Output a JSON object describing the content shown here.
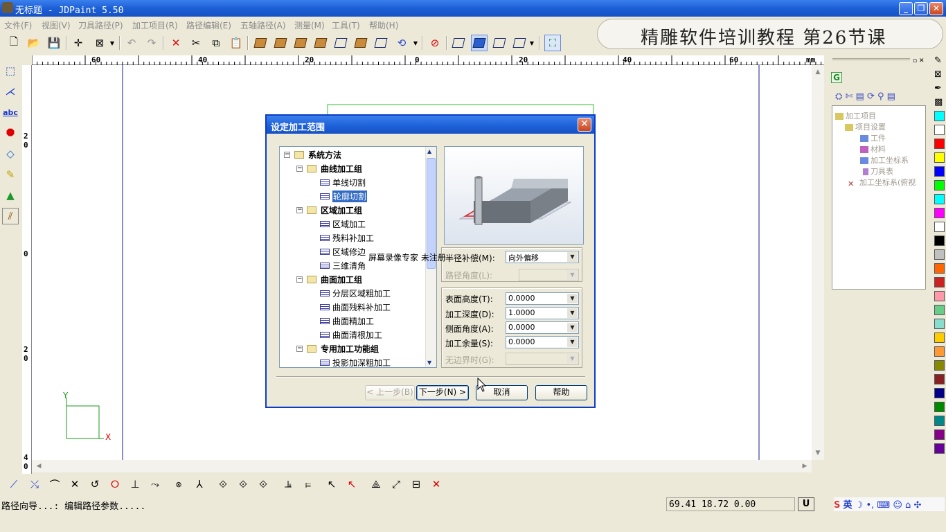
{
  "window": {
    "title": "无标题 - JDPaint 5.50"
  },
  "menu": [
    "文件(F)",
    "视图(V)",
    "刀具路径(P)",
    "加工项目(R)",
    "路径编辑(E)",
    "五轴路径(A)",
    "测量(M)",
    "工具(T)",
    "帮助(H)"
  ],
  "banner": "精雕软件培训教程 第26节课",
  "ruler": {
    "unit": "mm",
    "h_labels": [
      "60",
      "40",
      "20",
      "0",
      "20",
      "40",
      "60"
    ],
    "v_labels": [
      "2\n0",
      "0",
      "2\n0",
      "4\n0"
    ]
  },
  "axes": {
    "x": "X",
    "y": "Y"
  },
  "dialog": {
    "title": "设定加工范围",
    "close": "✕",
    "tree": [
      {
        "label": "系统方法",
        "level": 0,
        "type": "folder"
      },
      {
        "label": "曲线加工组",
        "level": 1,
        "type": "folder"
      },
      {
        "label": "单线切割",
        "level": 2,
        "type": "leaf"
      },
      {
        "label": "轮廓切割",
        "level": 2,
        "type": "leaf",
        "selected": true
      },
      {
        "label": "区域加工组",
        "level": 1,
        "type": "folder"
      },
      {
        "label": "区域加工",
        "level": 2,
        "type": "leaf"
      },
      {
        "label": "残料补加工",
        "level": 2,
        "type": "leaf"
      },
      {
        "label": "区域修边",
        "level": 2,
        "type": "leaf"
      },
      {
        "label": "三维清角",
        "level": 2,
        "type": "leaf"
      },
      {
        "label": "曲面加工组",
        "level": 1,
        "type": "folder"
      },
      {
        "label": "分层区域粗加工",
        "level": 2,
        "type": "leaf"
      },
      {
        "label": "曲面残料补加工",
        "level": 2,
        "type": "leaf"
      },
      {
        "label": "曲面精加工",
        "level": 2,
        "type": "leaf"
      },
      {
        "label": "曲面清根加工",
        "level": 2,
        "type": "leaf"
      },
      {
        "label": "专用加工功能组",
        "level": 1,
        "type": "folder"
      },
      {
        "label": "投影加深粗加工",
        "level": 2,
        "type": "leaf"
      }
    ],
    "fields": {
      "radius_comp": {
        "label": "半径补偿(M):",
        "value": "向外偏移"
      },
      "path_angle": {
        "label": "路径角度(L):",
        "value": ""
      },
      "surface_height": {
        "label": "表面高度(T):",
        "value": "0.0000"
      },
      "depth": {
        "label": "加工深度(D):",
        "value": "1.0000"
      },
      "side_angle": {
        "label": "侧面角度(A):",
        "value": "0.0000"
      },
      "allowance": {
        "label": "加工余量(S):",
        "value": "0.0000"
      },
      "no_boundary": {
        "label": "无边界时(G):",
        "value": ""
      }
    },
    "buttons": {
      "prev": "< 上一步(B)",
      "next": "下一步(N) >",
      "cancel": "取消",
      "help": "帮助"
    }
  },
  "watermark": "屏幕录像专家 未注册",
  "project_tree": [
    "加工项目",
    "项目设置",
    "工件",
    "材料",
    "加工坐标系",
    "刀具表",
    "加工坐标系(俯视"
  ],
  "panel_tab": "G",
  "status": {
    "text": "路径向导...: 编辑路径参数.....",
    "coords": "69.41 18.72 0.00",
    "mode": "U",
    "ime": "英"
  },
  "palette": [
    "#00ffff",
    "#ffffff",
    "#ff0000",
    "#ffff00",
    "#0000ff",
    "#00ff00",
    "#00ffff",
    "#ff00ff",
    "#ffffff",
    "#000000",
    "#c0c0c0",
    "#ff6600",
    "#cc2222",
    "#ff99aa",
    "#66cc88",
    "#88ddcc",
    "#ffcc00",
    "#ff9933",
    "#888800",
    "#882222",
    "#000088",
    "#008800",
    "#008888",
    "#880088",
    "#660099"
  ]
}
